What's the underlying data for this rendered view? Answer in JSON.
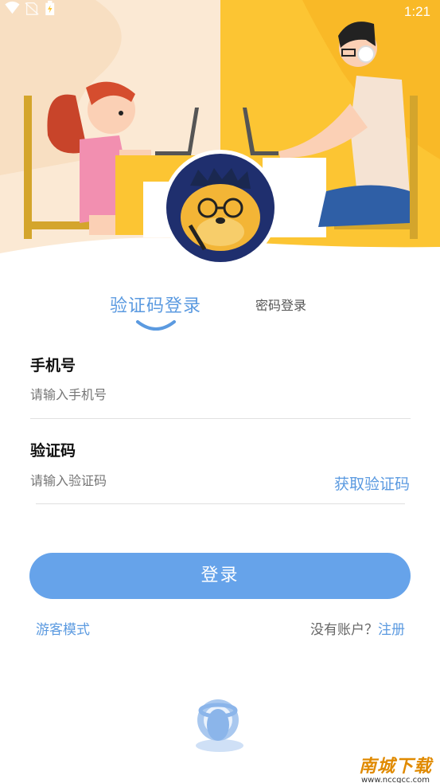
{
  "status_bar": {
    "time": "1:21"
  },
  "tabs": {
    "active": "验证码登录",
    "inactive": "密码登录"
  },
  "phone": {
    "label": "手机号",
    "placeholder": "请输入手机号"
  },
  "code": {
    "label": "验证码",
    "placeholder": "请输入验证码",
    "get_code": "获取验证码"
  },
  "login_button": "登录",
  "guest_mode": "游客模式",
  "no_account": "没有账户？",
  "register": "注册",
  "watermark": {
    "title": "南城下载",
    "url": "www.nccgcc.com"
  },
  "colors": {
    "accent": "#5b9ae0",
    "button": "#66a3ea",
    "hero_left": "#fbe9d4",
    "hero_right": "#fcc533"
  },
  "icons": [
    "wifi-icon",
    "no-sim-icon",
    "battery-icon",
    "mascot-avatar",
    "headset-logo-icon"
  ]
}
